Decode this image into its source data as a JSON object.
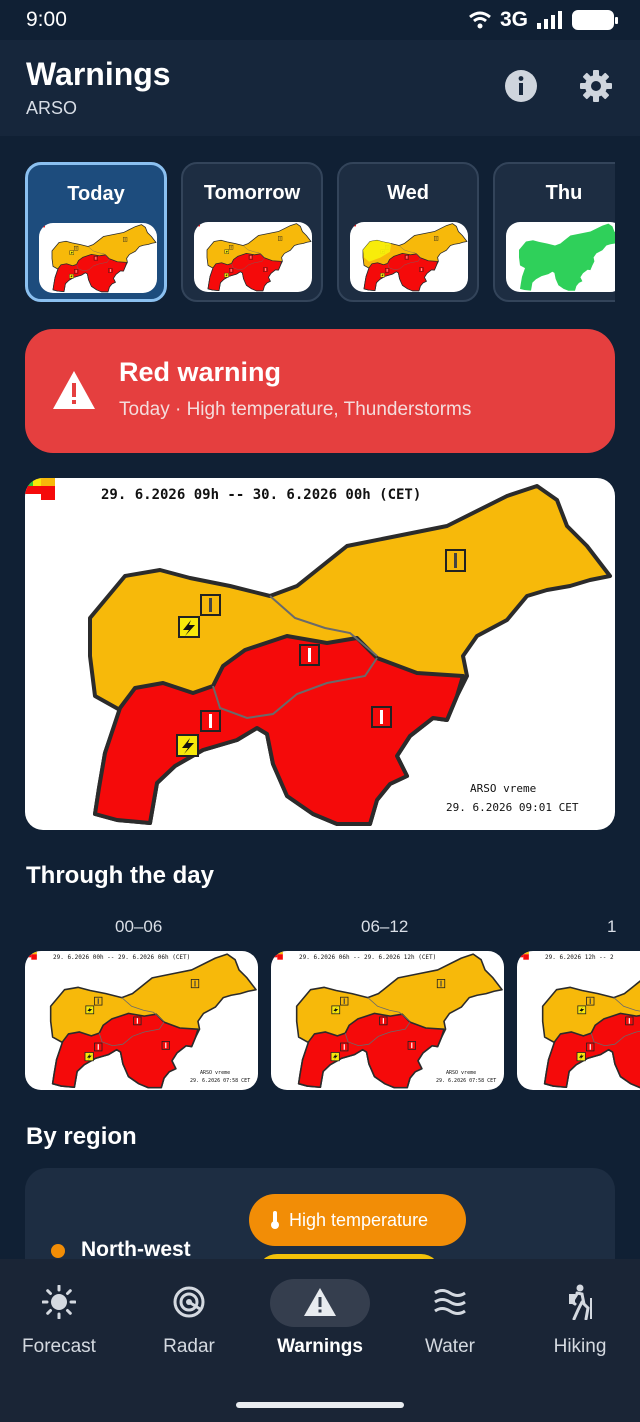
{
  "status": {
    "time": "9:00",
    "network": "3G"
  },
  "appbar": {
    "title": "Warnings",
    "subtitle": "ARSO",
    "info_icon": "info-icon",
    "settings_icon": "gear-icon"
  },
  "days": [
    {
      "label": "Today",
      "selected": true
    },
    {
      "label": "Tomorrow",
      "selected": false
    },
    {
      "label": "Wed",
      "selected": false
    },
    {
      "label": "Thu",
      "selected": false
    }
  ],
  "banner": {
    "title": "Red warning",
    "subtitle": "Today · High temperature, Thunderstorms",
    "color": "#e53f3f",
    "icon": "warning-triangle-icon"
  },
  "main_map": {
    "header": "29. 6.2026 09h -- 30. 6.2026 00h    (CET)",
    "footer_source": "ARSO vreme",
    "footer_time": "29. 6.2026  09:01 CET",
    "colors": {
      "red": "#f50a0a",
      "orange": "#f7b90a",
      "border": "#2b2b2b"
    }
  },
  "through_day": {
    "title": "Through the day",
    "slots": [
      {
        "label": "00–06",
        "header": "29. 6.2026 00h -- 29. 6.2026 06h    (CET)",
        "footer_source": "ARSO vreme",
        "footer_time": "29. 6.2026  07:58 CET"
      },
      {
        "label": "06–12",
        "header": "29. 6.2026 06h -- 29. 6.2026 12h    (CET)",
        "footer_source": "ARSO vreme",
        "footer_time": "29. 6.2026  07:58 CET"
      },
      {
        "label": "1",
        "header": "29. 6.2026 12h -- 2",
        "footer_source": "",
        "footer_time": ""
      }
    ]
  },
  "by_region": {
    "title": "By region",
    "regions": [
      {
        "name": "North-west",
        "warnings": [
          "High temperature"
        ]
      }
    ],
    "chip_colors": {
      "high_temperature": "#f28d06",
      "second": "#f2c10a"
    }
  },
  "nav": {
    "items": [
      {
        "label": "Forecast",
        "icon": "sun-icon",
        "active": false
      },
      {
        "label": "Radar",
        "icon": "radar-icon",
        "active": false
      },
      {
        "label": "Warnings",
        "icon": "warning-triangle-icon",
        "active": true
      },
      {
        "label": "Water",
        "icon": "waves-icon",
        "active": false
      },
      {
        "label": "Hiking",
        "icon": "hiking-icon",
        "active": false
      }
    ]
  }
}
